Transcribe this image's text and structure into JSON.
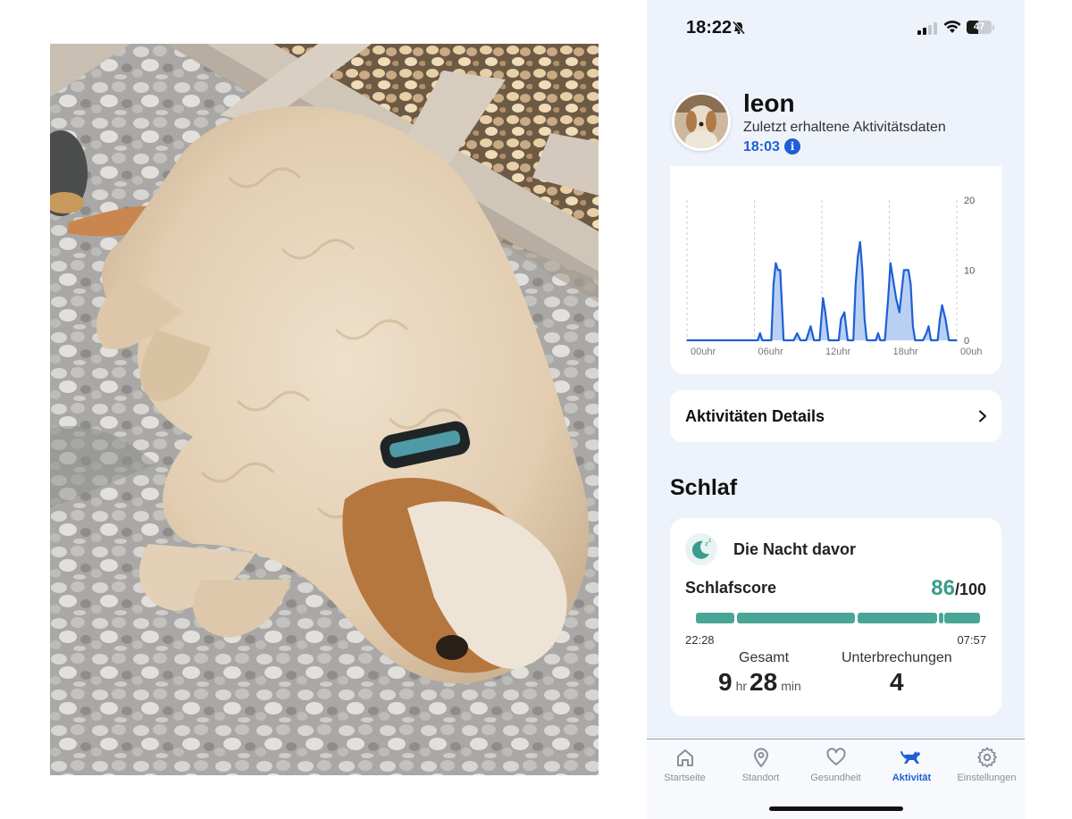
{
  "status_bar": {
    "time": "18:22",
    "battery": "47",
    "battery_level": 0.47
  },
  "profile": {
    "name": "leon",
    "last_data_label": "Zuletzt erhaltene Aktivitätsdaten",
    "last_data_time": "18:03",
    "info_glyph": "i"
  },
  "chart_data": {
    "type": "area",
    "x_ticks": [
      "00uhr",
      "06uhr",
      "12uhr",
      "18uhr",
      "00uh"
    ],
    "y_ticks": [
      "20",
      "10",
      "0"
    ],
    "ylim": [
      0,
      21
    ],
    "x_range_hours": [
      0,
      24
    ],
    "grid": "vertical dashed",
    "colors": {
      "fill": "#b9d0f3",
      "stroke": "#1f5fd6",
      "peak": "#2f6fe0"
    },
    "points": [
      [
        0,
        0
      ],
      [
        6.3,
        0
      ],
      [
        6.5,
        1
      ],
      [
        6.7,
        0
      ],
      [
        7.5,
        0
      ],
      [
        7.7,
        8
      ],
      [
        7.9,
        11
      ],
      [
        8.1,
        10
      ],
      [
        8.3,
        10
      ],
      [
        8.6,
        0
      ],
      [
        9.5,
        0
      ],
      [
        9.8,
        1
      ],
      [
        10.1,
        0
      ],
      [
        10.6,
        0
      ],
      [
        11.0,
        2
      ],
      [
        11.3,
        0
      ],
      [
        11.8,
        0
      ],
      [
        12.1,
        6
      ],
      [
        12.3,
        4
      ],
      [
        12.6,
        0
      ],
      [
        13.5,
        0
      ],
      [
        13.7,
        3
      ],
      [
        14.0,
        4
      ],
      [
        14.3,
        0
      ],
      [
        14.8,
        0
      ],
      [
        15.0,
        8
      ],
      [
        15.2,
        12
      ],
      [
        15.4,
        14
      ],
      [
        15.6,
        10
      ],
      [
        15.8,
        3
      ],
      [
        16.0,
        0
      ],
      [
        16.8,
        0
      ],
      [
        17.0,
        1
      ],
      [
        17.2,
        0
      ],
      [
        17.6,
        0
      ],
      [
        17.9,
        6
      ],
      [
        18.1,
        11
      ],
      [
        18.3,
        9
      ],
      [
        18.6,
        6
      ],
      [
        18.9,
        4
      ],
      [
        19.1,
        7
      ],
      [
        19.3,
        10
      ],
      [
        19.7,
        10
      ],
      [
        19.9,
        8
      ],
      [
        20.1,
        2
      ],
      [
        20.3,
        0
      ],
      [
        21.0,
        0
      ],
      [
        21.3,
        1
      ],
      [
        21.5,
        2
      ],
      [
        21.7,
        0
      ],
      [
        22.3,
        0
      ],
      [
        22.5,
        3
      ],
      [
        22.7,
        5
      ],
      [
        23.0,
        3
      ],
      [
        23.3,
        0
      ],
      [
        24,
        0
      ]
    ]
  },
  "details": {
    "label": "Aktivitäten Details"
  },
  "sleep": {
    "section_title": "Schlaf",
    "card_title": "Die Nacht davor",
    "score_label": "Schlafscore",
    "score": "86",
    "score_max": "/100",
    "start_time": "22:28",
    "end_time": "07:57",
    "segments": [
      [
        0.0,
        0.135
      ],
      [
        0.145,
        0.56
      ],
      [
        0.57,
        0.85
      ],
      [
        0.855,
        0.87
      ],
      [
        0.875,
        1.0
      ]
    ],
    "total_label": "Gesamt",
    "total_hours": "9",
    "hours_unit": "hr",
    "total_minutes": "28",
    "minutes_unit": "min",
    "interruptions_label": "Unterbrechungen",
    "interruptions": "4",
    "accent_color": "#4aa694"
  },
  "tabs": [
    {
      "label": "Startseite",
      "icon": "home-icon",
      "active": false
    },
    {
      "label": "Standort",
      "icon": "location-pin-icon",
      "active": false
    },
    {
      "label": "Gesundheit",
      "icon": "heart-icon",
      "active": false
    },
    {
      "label": "Aktivität",
      "icon": "running-dog-icon",
      "active": true
    },
    {
      "label": "Einstellungen",
      "icon": "gear-icon",
      "active": false
    }
  ]
}
